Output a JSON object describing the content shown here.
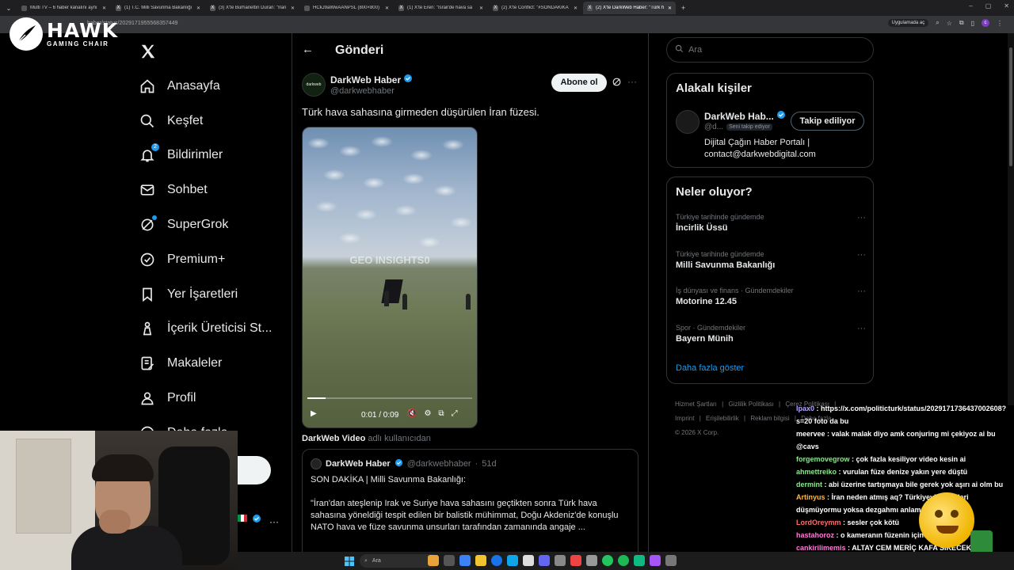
{
  "browser": {
    "tabs": [
      {
        "label": "Multi TV – 6 haber kanalını aynı",
        "active": false
      },
      {
        "label": "(1) T.C. Milli Savunma Bakanlığı",
        "active": false
      },
      {
        "label": "(3) X'te Burhanettin Duran: \"İran",
        "active": false
      },
      {
        "label": "HCkJ9aWwAANPSL (800×800)",
        "active": false
      },
      {
        "label": "(1) X'te Eren: \"İsrail'de hava sa",
        "active": false
      },
      {
        "label": "(2) X'te Conflict: \"#SONDAKİKA",
        "active": false
      },
      {
        "label": "(2) X'te DarkWeb Haber: \"Türk h",
        "active": true
      }
    ],
    "url": "haber/status/2029171955568357449",
    "app_chip": "Uygulamada aç",
    "profile_initial": "c"
  },
  "logo": {
    "name": "HAWK",
    "sub": "GAMING CHAIR"
  },
  "nav": {
    "items": [
      {
        "label": "Anasayfa",
        "icon": "home-icon"
      },
      {
        "label": "Keşfet",
        "icon": "search-icon"
      },
      {
        "label": "Bildirimler",
        "icon": "bell-icon",
        "badge": "2"
      },
      {
        "label": "Sohbet",
        "icon": "mail-icon"
      },
      {
        "label": "SuperGrok",
        "icon": "grok-icon"
      },
      {
        "label": "Premium+",
        "icon": "premium-icon"
      },
      {
        "label": "Yer İşaretleri",
        "icon": "bookmark-icon"
      },
      {
        "label": "İçerik Üreticisi St...",
        "icon": "creator-icon"
      },
      {
        "label": "Makaleler",
        "icon": "articles-icon"
      },
      {
        "label": "Profil",
        "icon": "profile-icon"
      },
      {
        "label": "Daha fazla",
        "icon": "more-icon"
      }
    ]
  },
  "main": {
    "title": "Gönderi",
    "author": {
      "name": "DarkWeb Haber",
      "handle": "@darkwebhaber",
      "avatar_text": "darkweb"
    },
    "subscribe_label": "Abone ol",
    "text": "Türk hava sahasına girmeden düşürülen İran füzesi.",
    "video": {
      "watermark": "GEO INSIGHTS0",
      "time": "0:01 / 0:09",
      "progress": 0.11
    },
    "by_user": "DarkWeb Video",
    "by_suffix": "adlı kullanıcıdan",
    "quote": {
      "name": "DarkWeb Haber",
      "handle": "@darkwebhaber",
      "age": "51d",
      "line1": "SON DAKİKA | Milli Savunma Bakanlığı:",
      "body": "\"İran'dan ateşlenip Irak ve Suriye hava sahasını geçtikten sonra Türk hava sahasına yöneldiği tespit edilen bir balistik mühimmat, Doğu Akdeniz'de konuşlu NATO hava ve füze savunma unsurları tarafından zamanında angaje ..."
    }
  },
  "right": {
    "search_placeholder": "Ara",
    "related": {
      "title": "Alakalı kişiler",
      "name": "DarkWeb Hab...",
      "handle": "@d...",
      "follows_you": "Seni takip ediyor",
      "follow_label": "Takip ediliyor",
      "bio": "Dijital Çağın Haber Portalı | contact@darkwebdigital.com"
    },
    "trends": {
      "title": "Neler oluyor?",
      "items": [
        {
          "context": "Türkiye tarihinde gündemde",
          "name": "İncirlik Üssü"
        },
        {
          "context": "Türkiye tarihinde gündemde",
          "name": "Milli Savunma Bakanlığı"
        },
        {
          "context": "İş dünyası ve finans · Gündemdekiler",
          "name": "Motorine 12.45"
        },
        {
          "context": "Spor · Gündemdekiler",
          "name": "Bayern Münih"
        }
      ],
      "show_more": "Daha fazla göster"
    },
    "footer": {
      "links": [
        "Hizmet Şartları",
        "|",
        "Gizlilik Politikası",
        "|",
        "Çerez Politikası",
        "|",
        "Imprint",
        "|",
        "Erişilebilirlik",
        "|",
        "Reklam bilgisi",
        "|",
        "Daha fazla ..."
      ],
      "copyright": "© 2026 X Corp."
    }
  },
  "chat": {
    "messages": [
      {
        "user": "Ipax0",
        "color": "#b7a6ff",
        "text": "https://x.com/politicturk/status/2029171736437002608?s=20 foto da bu"
      },
      {
        "user": "meervee",
        "color": "#ffffff",
        "text": "valak malak diyo amk conjuring mi çekiyoz ai bu @cavs"
      },
      {
        "user": "forgemovegrow",
        "color": "#8ee68e",
        "text": "çok fazla kesiliyor video kesin ai"
      },
      {
        "user": "ahmettreiko",
        "color": "#8ee68e",
        "text": "vurulan füze denize yakın yere düştü"
      },
      {
        "user": "dermint",
        "color": "#8ee68e",
        "text": "abi üzerine tartışmaya bile gerek yok aşırı ai olm bu"
      },
      {
        "user": "Artinyus",
        "color": "#ffb84d",
        "text": "İran neden atmış aq? Türkiyeyle ilişkileri düşmüyormu yoksa dezgahmı anlamadım?"
      },
      {
        "user": "LordOreymm",
        "color": "#ff6b6b",
        "text": "sesler çok kötü"
      },
      {
        "user": "hastahoroz",
        "color": "#ff7ad9",
        "text": "o kameranın füzenin içine girişi bile ai"
      },
      {
        "user": "cankirilimemis",
        "color": "#ff7ad9",
        "text": "ALTAY CEM MERİÇ KAFA SİKECEK OFFF"
      }
    ]
  },
  "taskbar": {
    "search_placeholder": "Ara"
  },
  "colors": {
    "accent": "#1d9bf0",
    "background": "#000000",
    "border": "#2f3336",
    "muted": "#71767b"
  }
}
